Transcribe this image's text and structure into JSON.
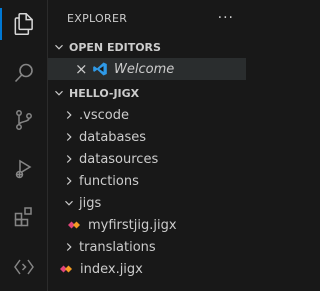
{
  "explorer": {
    "title": "EXPLORER",
    "more_label": "···"
  },
  "open_editors": {
    "title": "OPEN EDITORS",
    "items": [
      {
        "label": "Welcome",
        "close": "×"
      }
    ]
  },
  "workspace": {
    "title": "HELLO-JIGX",
    "items": [
      {
        "label": ".vscode",
        "type": "folder",
        "expanded": false
      },
      {
        "label": "databases",
        "type": "folder",
        "expanded": false
      },
      {
        "label": "datasources",
        "type": "folder",
        "expanded": false
      },
      {
        "label": "functions",
        "type": "folder",
        "expanded": false
      },
      {
        "label": "jigs",
        "type": "folder",
        "expanded": true
      },
      {
        "label": "myfirstjig.jigx",
        "type": "file",
        "parent": "jigs"
      },
      {
        "label": "translations",
        "type": "folder",
        "expanded": false
      },
      {
        "label": "index.jigx",
        "type": "file"
      }
    ]
  },
  "activity_bar": [
    "explorer-icon",
    "search-icon",
    "source-control-icon",
    "run-debug-icon",
    "extensions-icon",
    "remote-icon"
  ],
  "colors": {
    "background": "#181818",
    "accent": "#0078d4",
    "text": "#cccccc",
    "icon": "#858585",
    "vscode_blue": "#2f9ae8",
    "jigx_pink": "#e0457b",
    "jigx_orange": "#f59b23"
  }
}
